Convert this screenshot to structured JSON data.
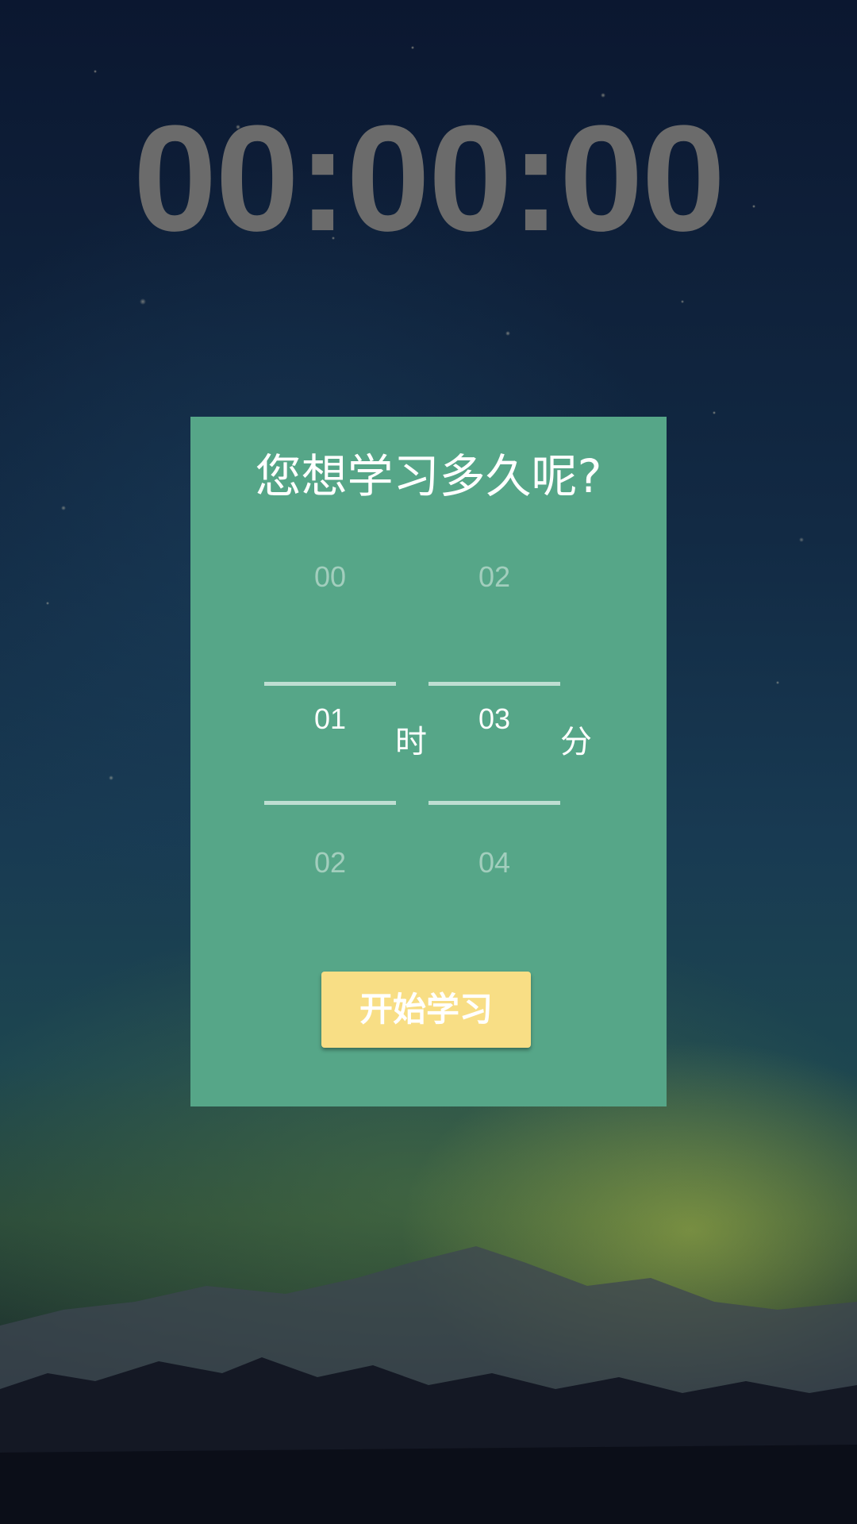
{
  "timer": {
    "display": "00:00:00"
  },
  "dialog": {
    "title": "您想学习多久呢?",
    "hour_picker": {
      "prev": "00",
      "selected": "01",
      "next": "02",
      "unit": "时"
    },
    "minute_picker": {
      "prev": "02",
      "selected": "03",
      "next": "04",
      "unit": "分"
    },
    "start_button_label": "开始学习"
  },
  "colors": {
    "card_background": "#56a688",
    "button_background": "#f8de85",
    "timer_text": "#6b6b6b"
  }
}
